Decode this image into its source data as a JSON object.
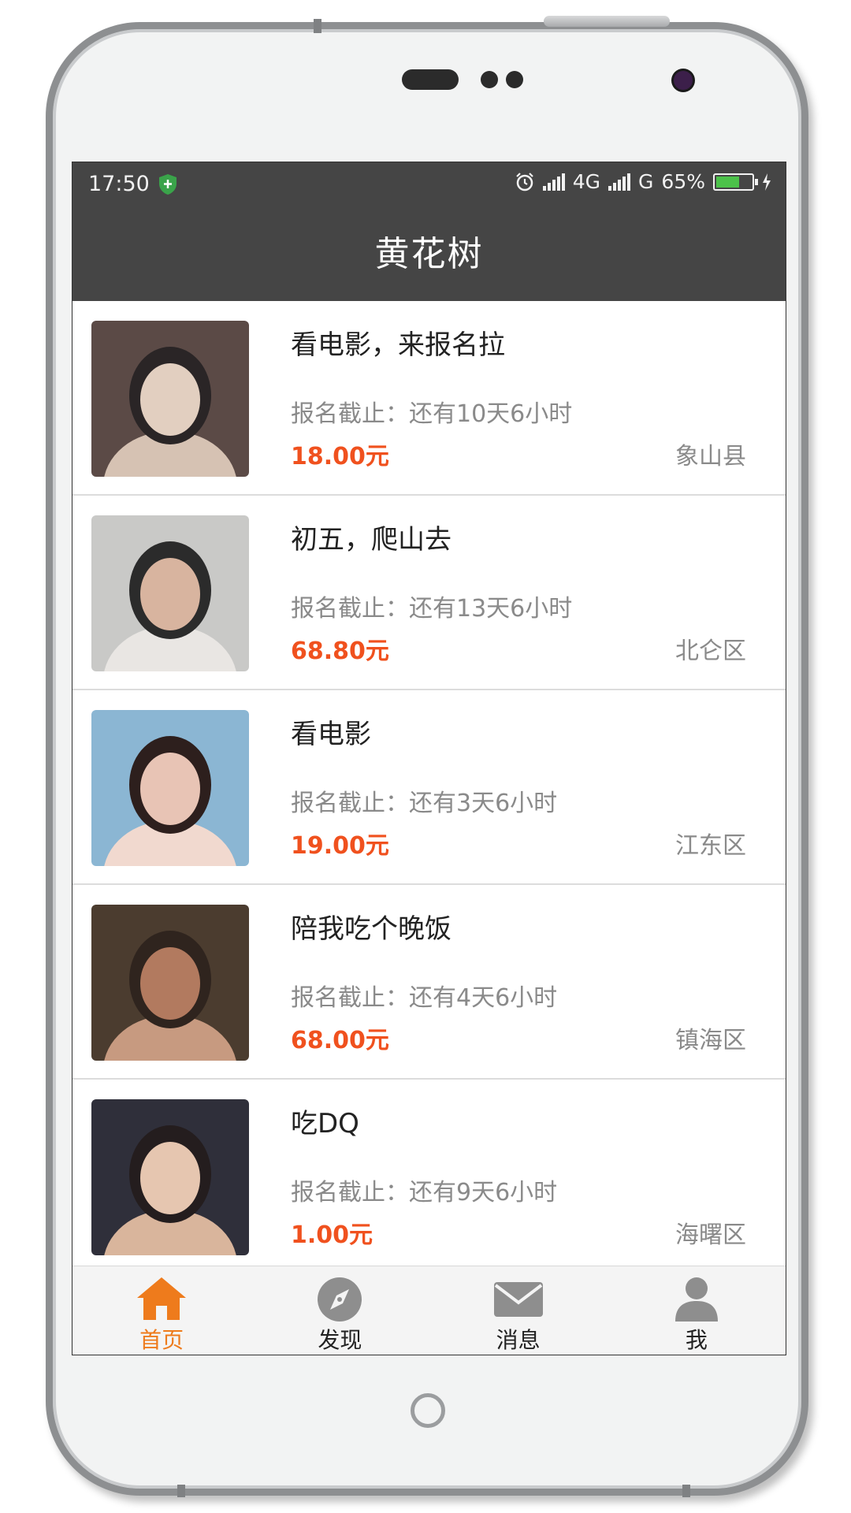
{
  "status_bar": {
    "time": "17:50",
    "network_1": "4G",
    "network_2": "G",
    "battery": "65%",
    "battery_level": 0.65
  },
  "header": {
    "title": "黄花树"
  },
  "events": [
    {
      "title": "看电影，来报名拉",
      "deadline": "报名截止：还有10天6小时",
      "price": "18.00元",
      "area": "象山县"
    },
    {
      "title": "初五，爬山去",
      "deadline": "报名截止：还有13天6小时",
      "price": "68.80元",
      "area": "北仑区"
    },
    {
      "title": "看电影",
      "deadline": "报名截止：还有3天6小时",
      "price": "19.00元",
      "area": "江东区"
    },
    {
      "title": "陪我吃个晚饭",
      "deadline": "报名截止：还有4天6小时",
      "price": "68.00元",
      "area": "镇海区"
    },
    {
      "title": "吃DQ",
      "deadline": "报名截止：还有9天6小时",
      "price": "1.00元",
      "area": "海曙区"
    }
  ],
  "tabs": [
    {
      "label": "首页",
      "icon": "home-icon",
      "active": true
    },
    {
      "label": "发现",
      "icon": "compass-icon",
      "active": false
    },
    {
      "label": "消息",
      "icon": "mail-icon",
      "active": false
    },
    {
      "label": "我",
      "icon": "user-icon",
      "active": false
    }
  ],
  "colors": {
    "header_bg": "#454545",
    "price": "#f0511e",
    "active_tab": "#ee7b1c"
  }
}
